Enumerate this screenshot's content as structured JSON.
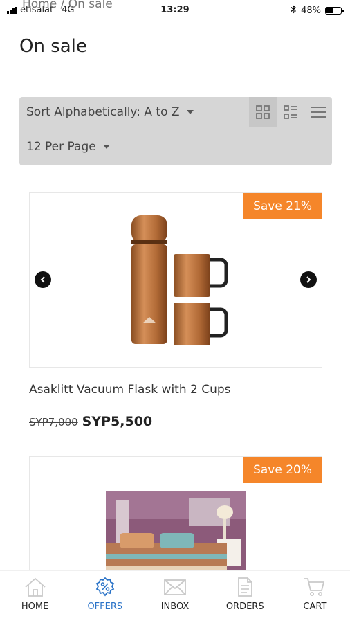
{
  "status_bar": {
    "carrier": "etisalat",
    "network": "4G",
    "time": "13:29",
    "battery": "48%",
    "battery_level": 0.48
  },
  "breadcrumb": "Home / On sale",
  "page_title": "On sale",
  "toolbar": {
    "sort_label": "Sort Alphabetically: A to Z",
    "per_page_label": "12 Per Page",
    "active_view": "grid"
  },
  "products": [
    {
      "name": "Asaklitt Vacuum Flask with 2 Cups",
      "old_price": "SYP7,000",
      "new_price": "SYP5,500",
      "badge": "Save 21%"
    },
    {
      "badge": "Save 20%"
    }
  ],
  "nav": [
    {
      "label": "HOME",
      "icon": "home-icon"
    },
    {
      "label": "OFFERS",
      "icon": "percent-icon",
      "active": true
    },
    {
      "label": "INBOX",
      "icon": "mail-icon"
    },
    {
      "label": "ORDERS",
      "icon": "document-icon"
    },
    {
      "label": "CART",
      "icon": "cart-icon"
    }
  ],
  "colors": {
    "accent": "#f5862a",
    "active_nav": "#2a73c8",
    "toolbar_bg": "#d6d6d6"
  }
}
